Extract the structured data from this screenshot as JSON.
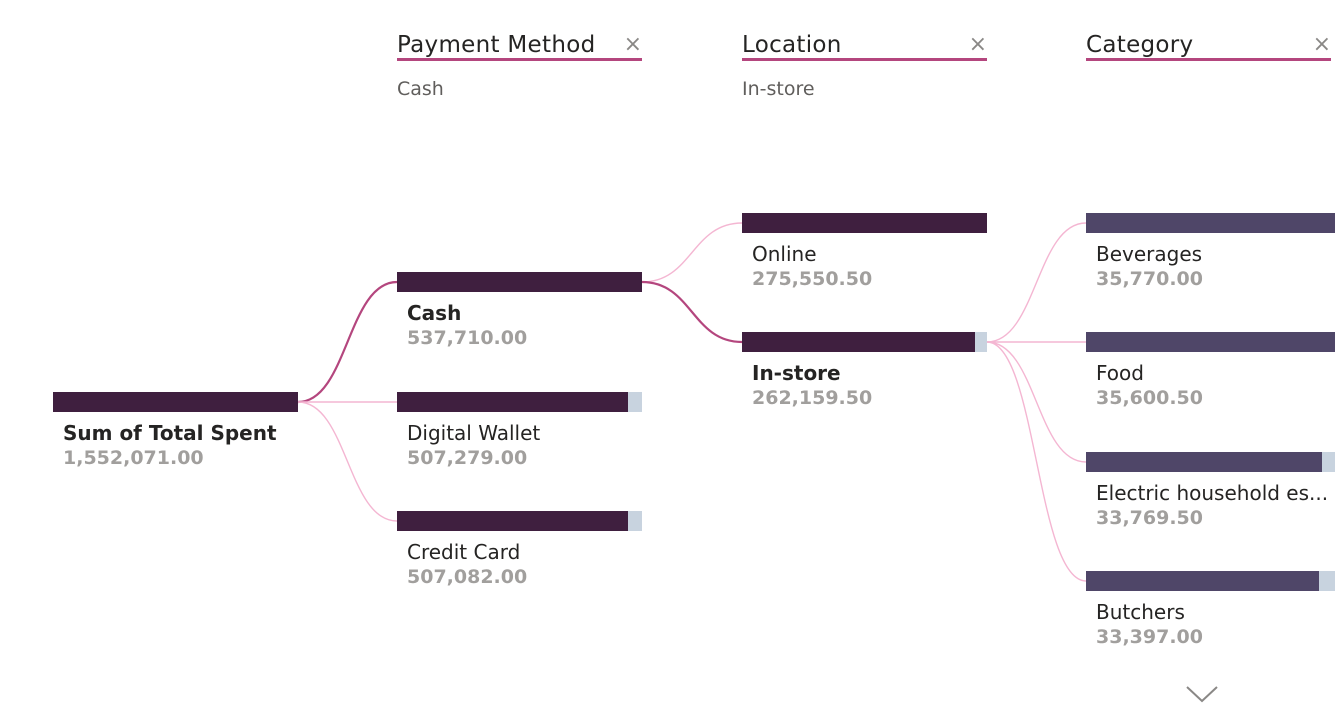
{
  "chart_data": {
    "type": "decomposition-tree",
    "root": {
      "label": "Sum of Total Spent",
      "value": "1,552,071.00"
    },
    "levels": [
      {
        "title": "Payment Method",
        "selected": "Cash",
        "nodes": [
          {
            "label": "Cash",
            "value": "537,710.00",
            "amount": 537710.0
          },
          {
            "label": "Digital Wallet",
            "value": "507,279.00",
            "amount": 507279.0
          },
          {
            "label": "Credit Card",
            "value": "507,082.00",
            "amount": 507082.0
          }
        ]
      },
      {
        "title": "Location",
        "selected": "In-store",
        "nodes": [
          {
            "label": "Online",
            "value": "275,550.50",
            "amount": 275550.5
          },
          {
            "label": "In-store",
            "value": "262,159.50",
            "amount": 262159.5
          }
        ]
      },
      {
        "title": "Category",
        "selected": "",
        "nodes": [
          {
            "label": "Beverages",
            "value": "35,770.00",
            "amount": 35770.0
          },
          {
            "label": "Food",
            "value": "35,600.50",
            "amount": 35600.5
          },
          {
            "label": "Electric household es...",
            "value": "33,769.50",
            "amount": 33769.5
          },
          {
            "label": "Butchers",
            "value": "33,397.00",
            "amount": 33397.0
          }
        ]
      }
    ],
    "close_glyph": "×",
    "colors": {
      "bar_dark": "#3f1f3f",
      "bar_category": "#4f4668",
      "bar_track": "#c8d3df",
      "path_selected": "#b4467e",
      "path_other": "#f4b6d2",
      "header_underline": "#b4467e"
    },
    "icons": {
      "more": "chevron-down-icon",
      "close": "close-icon"
    }
  }
}
